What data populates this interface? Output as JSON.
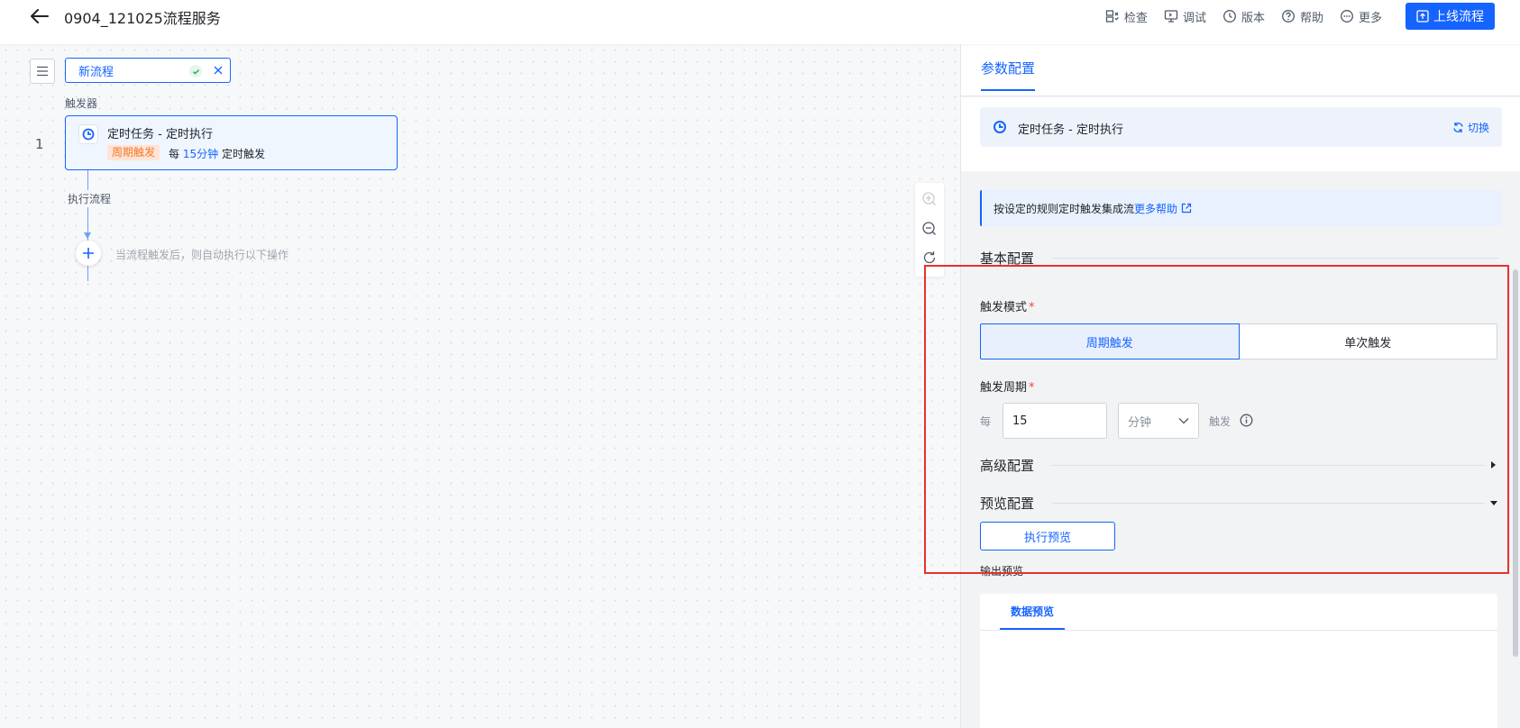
{
  "header": {
    "title": "0904_121025流程服务",
    "tools": [
      {
        "icon": "inspect-icon",
        "label": "检查"
      },
      {
        "icon": "debug-icon",
        "label": "调试"
      },
      {
        "icon": "version-icon",
        "label": "版本"
      },
      {
        "icon": "help-icon",
        "label": "帮助"
      },
      {
        "icon": "more-icon",
        "label": "更多"
      }
    ],
    "publish_label": "上线流程"
  },
  "canvas": {
    "flow_name": "新流程",
    "trigger_section_label": "触发器",
    "step_number": "1",
    "trigger_card": {
      "title": "定时任务 - 定时执行",
      "tag": "周期触发",
      "desc_prefix": "每",
      "desc_highlight": "15分钟",
      "desc_suffix": "定时触发"
    },
    "exec_label": "执行流程",
    "add_hint": "当流程触发后，则自动执行以下操作"
  },
  "panel": {
    "tab_label": "参数配置",
    "trigger_chip_title": "定时任务 - 定时执行",
    "switch_label": "切换",
    "info_text": "按设定的规则定时触发集成流",
    "info_link": "更多帮助",
    "basic_section": "基本配置",
    "trigger_mode_label": "触发模式",
    "trigger_mode_options": [
      "周期触发",
      "单次触发"
    ],
    "trigger_mode_selected": "周期触发",
    "trigger_cycle_label": "触发周期",
    "every_label": "每",
    "cycle_value": "15",
    "cycle_unit": "分钟",
    "trigger_suffix": "触发",
    "advanced_section": "高级配置",
    "preview_section": "预览配置",
    "preview_button": "执行预览",
    "output_label": "输出预览",
    "data_preview_tab": "数据预览"
  },
  "colors": {
    "accent": "#1664ff",
    "tag_bg": "#ffe4d6",
    "tag_text": "#f5782a",
    "highlight_border": "#e8312a"
  }
}
